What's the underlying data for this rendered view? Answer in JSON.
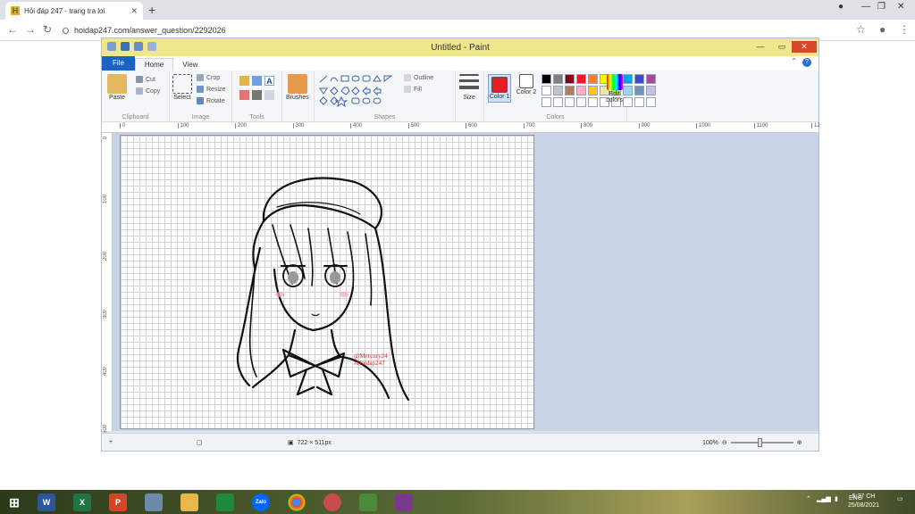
{
  "browser": {
    "tab_title": "Hỏi đáp 247 - trang tra loi",
    "url": "hoidap247.com/answer_question/2292026"
  },
  "paint": {
    "window_title": "Untitled - Paint",
    "menu": {
      "file": "File",
      "home": "Home",
      "view": "View"
    },
    "clipboard": {
      "paste": "Paste",
      "cut": "Cut",
      "copy": "Copy",
      "label": "Clipboard"
    },
    "image": {
      "select": "Select",
      "crop": "Crop",
      "resize": "Resize",
      "rotate": "Rotate",
      "label": "Image"
    },
    "tools": {
      "label": "Tools",
      "brushes": "Brushes"
    },
    "shapes": {
      "outline": "Outline",
      "fill": "Fill",
      "label": "Shapes"
    },
    "size_label": "Size",
    "color1": {
      "label": "Color 1",
      "value": "#e51c23"
    },
    "color2": {
      "label": "Color 2",
      "value": "#ffffff"
    },
    "colors_label": "Colors",
    "edit_colors": "Edit colors",
    "palette": [
      "#000000",
      "#7f7f7f",
      "#880015",
      "#ed1c24",
      "#ff7f27",
      "#fff200",
      "#22b14c",
      "#00a2e8",
      "#3f48cc",
      "#a349a4",
      "#ffffff",
      "#c3c3c3",
      "#b97a57",
      "#ffaec9",
      "#ffc90e",
      "#efe4b0",
      "#b5e61d",
      "#99d9ea",
      "#7092be",
      "#c8bfe7"
    ],
    "ruler_h": [
      "0",
      "100",
      "200",
      "300",
      "400",
      "500",
      "600",
      "700",
      "800",
      "900",
      "1000",
      "1100",
      "12"
    ],
    "ruler_v": [
      "0",
      "100",
      "200",
      "300",
      "400",
      "500"
    ],
    "watermark": [
      "@Mercury24",
      "#Hoidap247"
    ],
    "status": {
      "dimensions": "722 × 511px",
      "zoom": "100%"
    }
  },
  "taskbar": {
    "apps": [
      "W",
      "X",
      "P",
      "",
      "",
      "",
      "Zalo",
      "",
      "",
      "",
      ""
    ],
    "lang": "ENG",
    "time": "5:37 CH",
    "date": "25/08/2021"
  }
}
